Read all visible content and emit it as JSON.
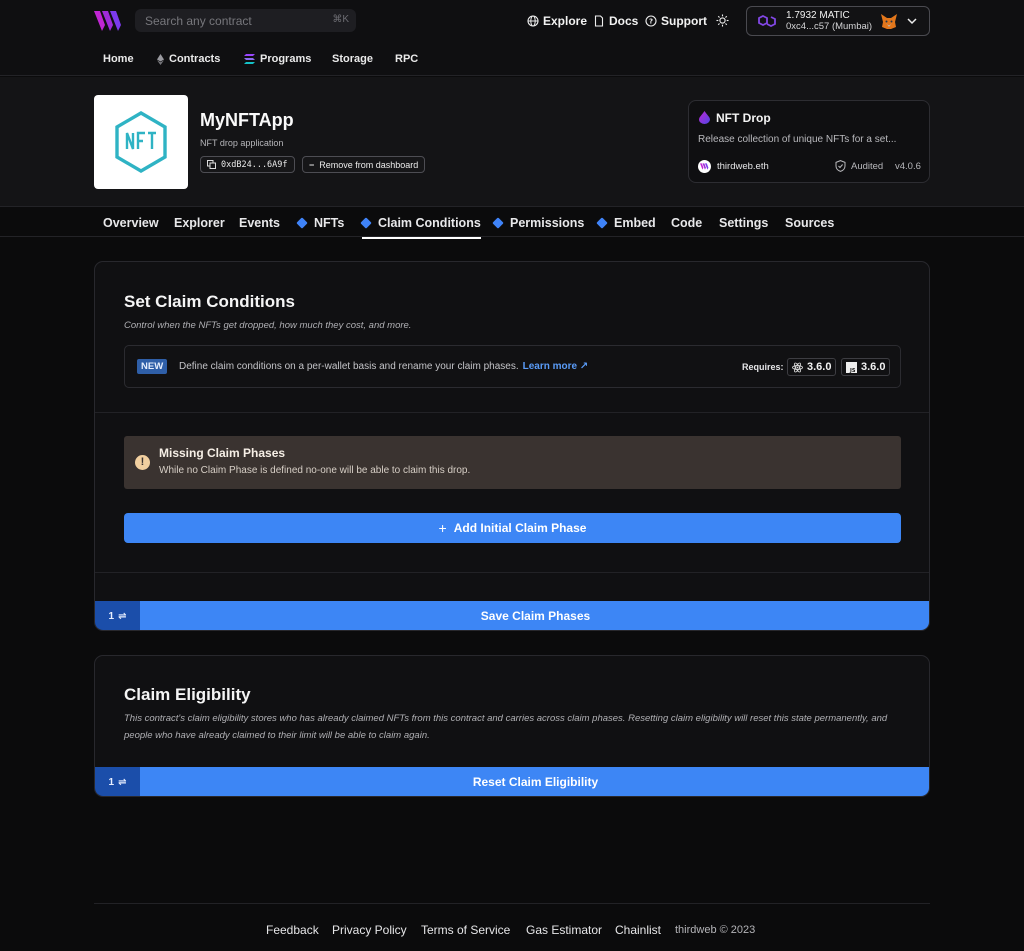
{
  "header": {
    "search_placeholder": "Search any contract",
    "search_shortcut": "⌘K",
    "links": [
      "Explore",
      "Docs",
      "Support"
    ],
    "wallet": {
      "balance": "1.7932 MATIC",
      "address": "0xc4...c57 (Mumbai)"
    },
    "nav": [
      "Home",
      "Contracts",
      "Programs",
      "Storage",
      "RPC"
    ]
  },
  "contract": {
    "name": "MyNFTApp",
    "subtitle": "NFT drop application",
    "address": "0xdB24...6A9f",
    "remove_label": "Remove from dashboard",
    "card": {
      "title": "NFT Drop",
      "description": "Release collection of unique NFTs for a set...",
      "publisher": "thirdweb.eth",
      "audited": "Audited",
      "version": "v4.0.6"
    }
  },
  "tabs": [
    "Overview",
    "Explorer",
    "Events",
    "NFTs",
    "Claim Conditions",
    "Permissions",
    "Embed",
    "Code",
    "Settings",
    "Sources"
  ],
  "claim": {
    "title": "Set Claim Conditions",
    "description": "Control when the NFTs get dropped, how much they cost, and more.",
    "new_badge": "NEW",
    "notice": "Define claim conditions on a per-wallet basis and rename your claim phases.",
    "learn_more": "Learn more ↗",
    "requires_label": "Requires:",
    "versions": [
      "3.6.0",
      "3.6.0"
    ],
    "warning_title": "Missing Claim Phases",
    "warning_text": "While no Claim Phase is defined no-one will be able to claim this drop.",
    "add_phase": "Add Initial Claim Phase",
    "count": "1",
    "save": "Save Claim Phases"
  },
  "eligibility": {
    "title": "Claim Eligibility",
    "description": "This contract's claim eligibility stores who has already claimed NFTs from this contract and carries across claim phases. Resetting claim eligibility will reset this state permanently, and people who have already claimed to their limit will be able to claim again.",
    "count": "1",
    "reset": "Reset Claim Eligibility"
  },
  "footer": {
    "links": [
      "Feedback",
      "Privacy Policy",
      "Terms of Service",
      "Gas Estimator",
      "Chainlist"
    ],
    "copyright": "thirdweb © 2023"
  }
}
